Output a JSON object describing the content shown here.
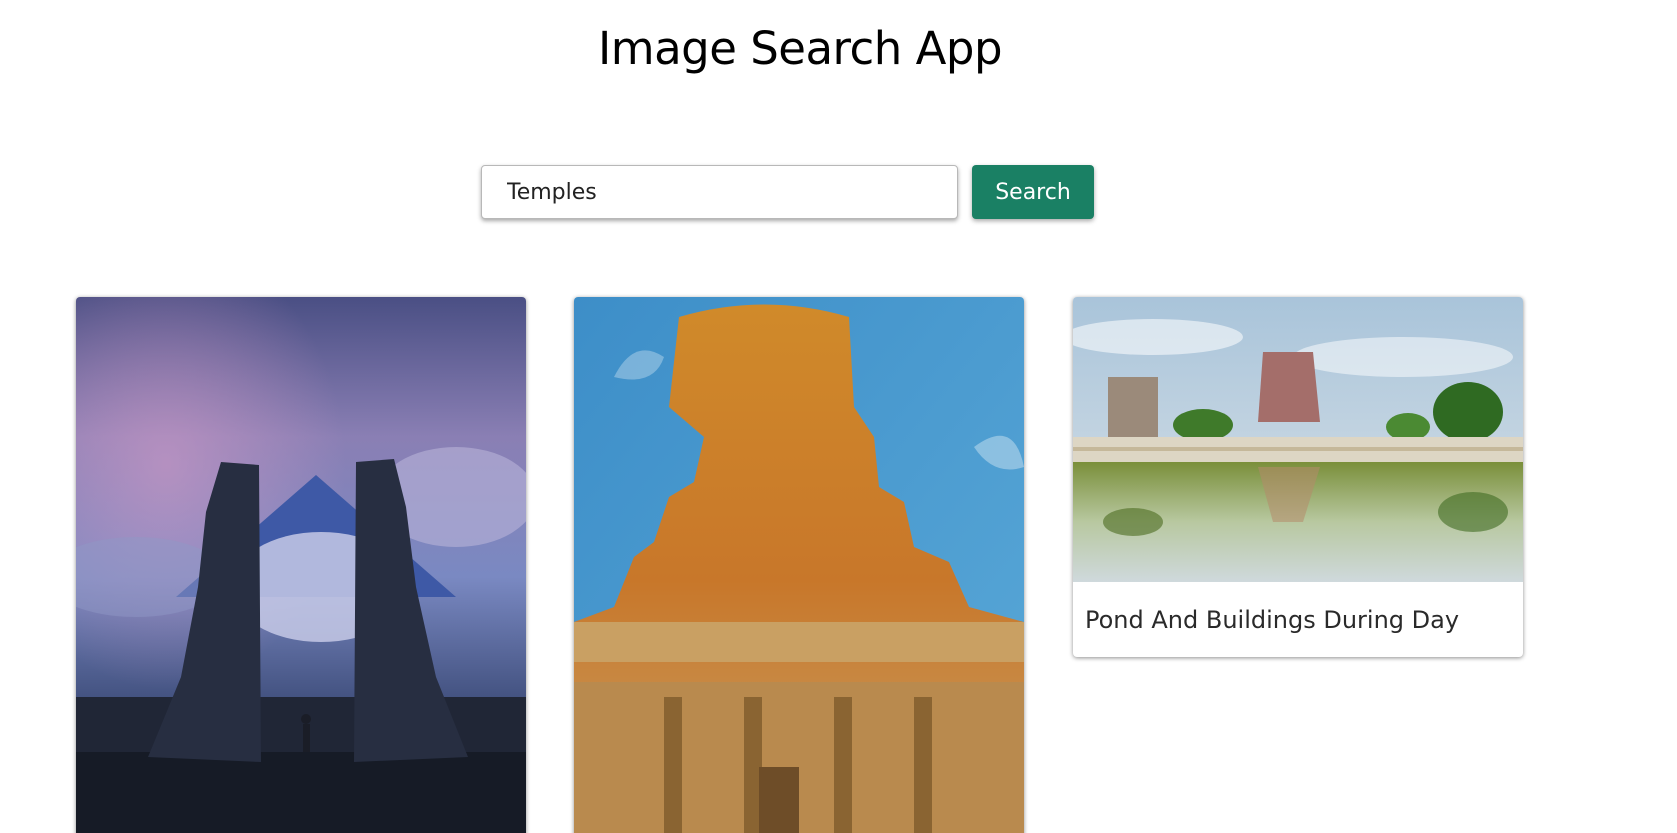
{
  "app": {
    "title": "Image Search App"
  },
  "search": {
    "value": "Temples",
    "button_label": "Search"
  },
  "results": [
    {
      "image": "bali-temple-gate-photo",
      "caption": ""
    },
    {
      "image": "carved-stone-temple-photo",
      "caption": ""
    },
    {
      "image": "temple-pond-photo",
      "caption": "Pond And Buildings During Day"
    }
  ],
  "colors": {
    "accent": "#1a8064"
  }
}
